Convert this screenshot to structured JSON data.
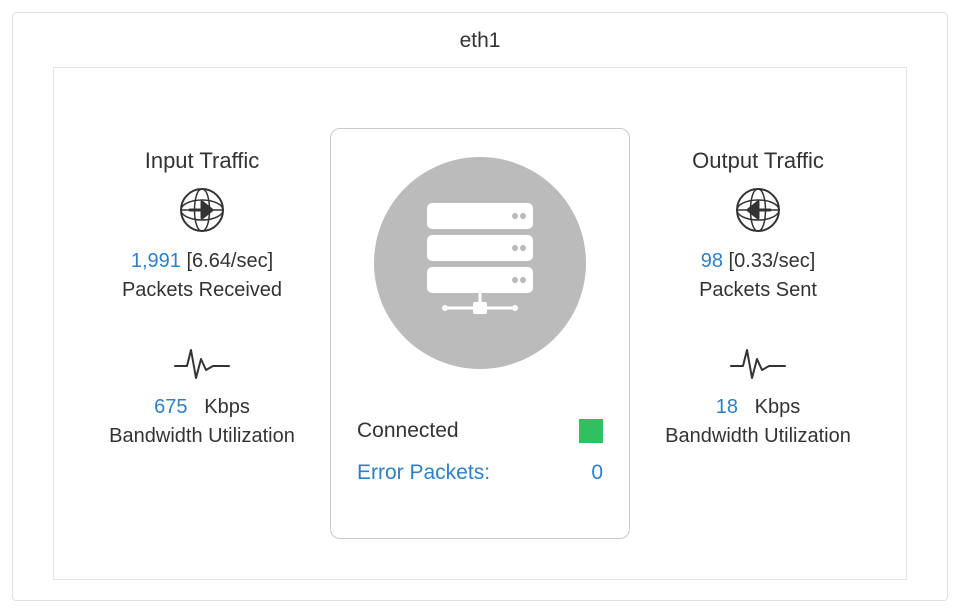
{
  "interface_name": "eth1",
  "input": {
    "title": "Input Traffic",
    "packets_value": "1,991",
    "packets_rate": "[6.64/sec]",
    "packets_label": "Packets Received",
    "bandwidth_value": "675",
    "bandwidth_unit": "Kbps",
    "bandwidth_label": "Bandwidth Utilization"
  },
  "output": {
    "title": "Output Traffic",
    "packets_value": "98",
    "packets_rate": "[0.33/sec]",
    "packets_label": "Packets Sent",
    "bandwidth_value": "18",
    "bandwidth_unit": "Kbps",
    "bandwidth_label": "Bandwidth Utilization"
  },
  "center": {
    "status_label": "Connected",
    "status_color": "#30c060",
    "error_label": "Error Packets:",
    "error_value": "0"
  }
}
